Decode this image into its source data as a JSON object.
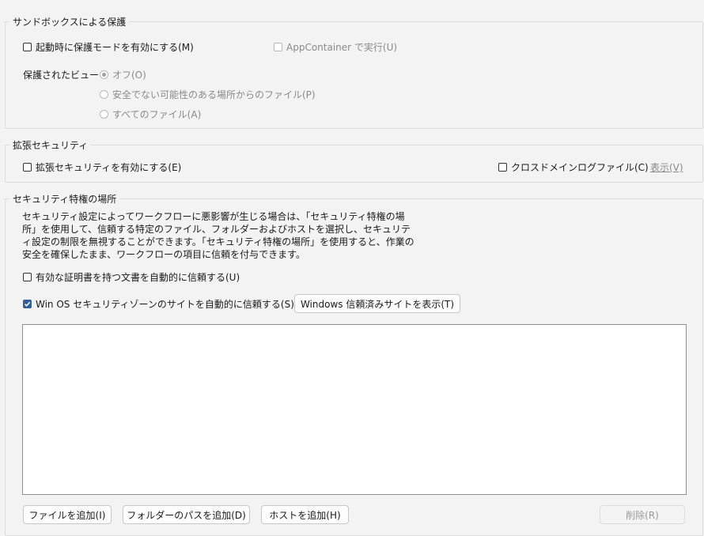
{
  "sandbox": {
    "title": "サンドボックスによる保護",
    "startup_protected_mode": "起動時に保護モードを有効にする(M)",
    "app_container": "AppContainer で実行(U)",
    "protected_view_label": "保護されたビュー",
    "pv_options": [
      "オフ(O)",
      "安全でない可能性のある場所からのファイル(P)",
      "すべてのファイル(A)"
    ]
  },
  "enhanced": {
    "title": "拡張セキュリティ",
    "enable": "拡張セキュリティを有効にする(E)",
    "cross_domain_log": "クロスドメインログファイル(C)",
    "view_link": "表示(V)"
  },
  "privileged": {
    "title": "セキュリティ特権の場所",
    "description": "セキュリティ設定によってワークフローに悪影響が生じる場合は、「セキュリティ特権の場所」を使用して、信頼する特定のファイル、フォルダーおよびホストを選択し、セキュリティ設定の制限を無視することができます。「セキュリティ特権の場所」を使用すると、作業の安全を確保したまま、ワークフローの項目に信頼を付与できます。",
    "trust_certified": "有効な証明書を持つ文書を自動的に信頼する(U)",
    "trust_os_zone": "Win OS セキュリティゾーンのサイトを自動的に信頼する(S)",
    "view_trusted_sites": "Windows 信頼済みサイトを表示(T)",
    "add_file": "ファイルを追加(I)",
    "add_folder": "フォルダーのパスを追加(D)",
    "add_host": "ホストを追加(H)",
    "remove": "削除(R)"
  },
  "colors": {
    "accent": "#2f5f9e",
    "background": "#f3f3f3"
  }
}
